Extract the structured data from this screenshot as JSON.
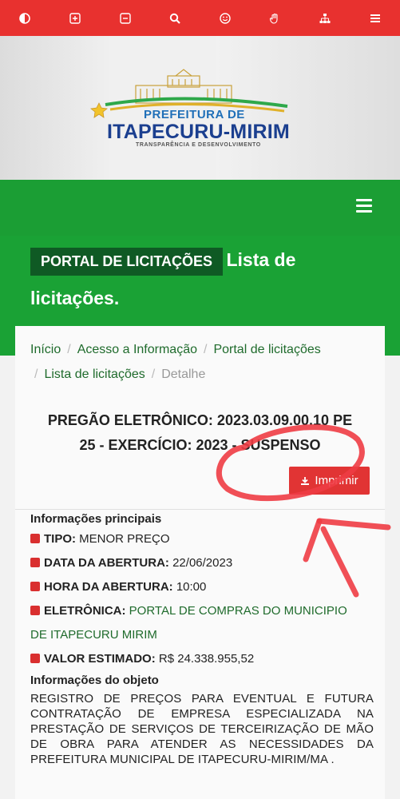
{
  "toolbar": {
    "color": "#e8312f",
    "icons": [
      "contrast-icon",
      "zoom-in-icon",
      "zoom-out-icon",
      "search-icon",
      "smile-icon",
      "hand-icon",
      "sitemap-icon",
      "menu-icon"
    ]
  },
  "logo": {
    "line1": "PREFEITURA DE",
    "line2": "ITAPECURU-MIRIM",
    "line3": "TRANSPARÊNCIA E DESENVOLVIMENTO"
  },
  "page": {
    "badge": "PORTAL DE LICITAÇÕES",
    "title_part1": "Lista de",
    "title_part2": "licitações.",
    "green": "#1aa235"
  },
  "breadcrumb": {
    "items": [
      "Início",
      "Acesso a Informação",
      "Portal de licitações",
      "Lista de licitações"
    ],
    "current": "Detalhe"
  },
  "licitacao": {
    "title_line1": "PREGÃO ELETRÔNICO: 2023.03.09.00.10 PE",
    "title_line2": "25 - EXERCÍCIO: 2023 - SUSPENSO",
    "print_label": "Imprimir"
  },
  "info": {
    "heading": "Informações principais",
    "tipo_label": "TIPO:",
    "tipo_value": "MENOR PREÇO",
    "data_label": "DATA DA ABERTURA:",
    "data_value": "22/06/2023",
    "hora_label": "HORA DA ABERTURA:",
    "hora_value": "10:00",
    "eletronica_label": "ELETRÔNICA:",
    "eletronica_value_1": "PORTAL DE COMPRAS DO MUNICIPIO",
    "eletronica_value_2": "DE ITAPECURU MIRIM",
    "valor_label": "VALOR ESTIMADO:",
    "valor_value": "R$ 24.338.955,52",
    "objeto_heading": "Informações do objeto",
    "objeto_text": "REGISTRO DE PREÇOS PARA EVENTUAL E FUTURA CONTRATAÇÃO DE EMPRESA ESPECIALIZADA NA PRESTAÇÃO DE SERVIÇOS DE TERCEIRIZAÇÃO DE MÃO DE OBRA PARA ATENDER AS NECESSIDADES DA PREFEITURA MUNICIPAL DE ITAPECURU-MIRIM/MA ."
  }
}
